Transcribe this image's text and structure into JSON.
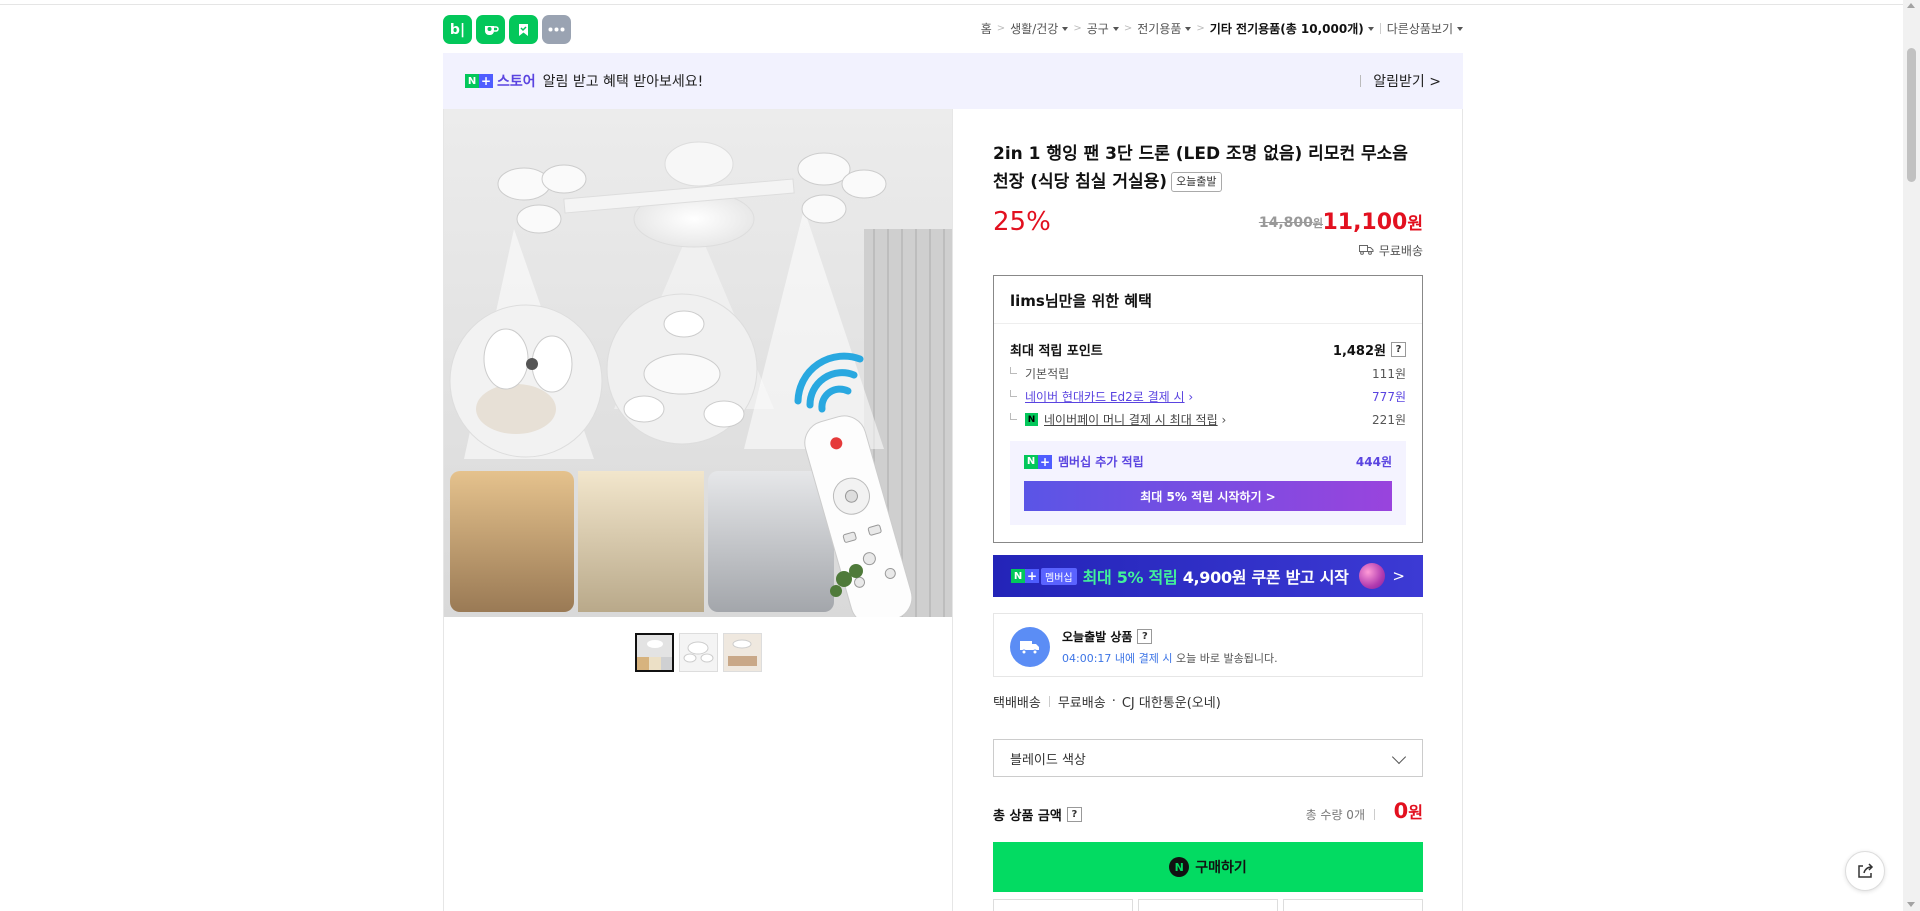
{
  "header": {
    "app_icons": [
      {
        "name": "blog-icon",
        "glyph": "b|"
      },
      {
        "name": "cafe-icon",
        "glyph": "☕"
      },
      {
        "name": "bookmark-icon",
        "glyph": "▮"
      },
      {
        "name": "more-icon",
        "glyph": "•••"
      }
    ],
    "breadcrumbs": [
      "홈",
      "생활/건강",
      "공구",
      "전기용품",
      "기타 전기용품(총 10,000개)"
    ],
    "other_products": "다른상품보기"
  },
  "banner": {
    "store": "스토어",
    "message": "알림 받고 혜택 받아보세요!",
    "alarm": "알림받기 >"
  },
  "product": {
    "title": "2in 1 행잉 팬 3단 드론 (LED 조명 없음) 리모컨 무소음 천장 (식당 침실 거실용)",
    "chip": "오늘출발",
    "discount": "25%",
    "original_price": "14,800",
    "original_unit": "원",
    "sale_price": "11,100",
    "sale_unit": "원",
    "shipping": "무료배송"
  },
  "benefit": {
    "title": "lims님만을 위한 혜택",
    "max_points_label": "최대 적립 포인트",
    "max_points_value": "1,482원",
    "basic_label": "기본적립",
    "basic_value": "111원",
    "card_label": "네이버 현대카드 Ed2로 결제 시",
    "card_value": "777원",
    "npay_label": "네이버페이 머니 결제 시 최대 적립",
    "npay_value": "221원",
    "member_label": "멤버십 추가 적립",
    "member_value": "444원",
    "member_cta": "최대 5% 적립 시작하기 >"
  },
  "promo": {
    "tag": "멤버십",
    "highlight": "최대 5% 적립",
    "rest": "4,900원 쿠폰 받고 시작",
    "arrow": ">"
  },
  "today_ship": {
    "title": "오늘출발 상품",
    "time": "04:00:17 내에 결제 시",
    "rest": "오늘 바로 발송됩니다."
  },
  "delivery": {
    "type": "택배배송",
    "fee": "무료배송",
    "carrier": "CJ 대한통운(오네)"
  },
  "option": {
    "label": "블레이드 색상"
  },
  "total": {
    "label": "총 상품 금액",
    "qty": "총 수량 0개",
    "amount": "0",
    "unit": "원"
  },
  "buy": {
    "label": "구매하기"
  },
  "colors": {
    "naver_green": "#03c75a",
    "price_red": "#e2101f",
    "membership_purple": "#5a44e0"
  }
}
